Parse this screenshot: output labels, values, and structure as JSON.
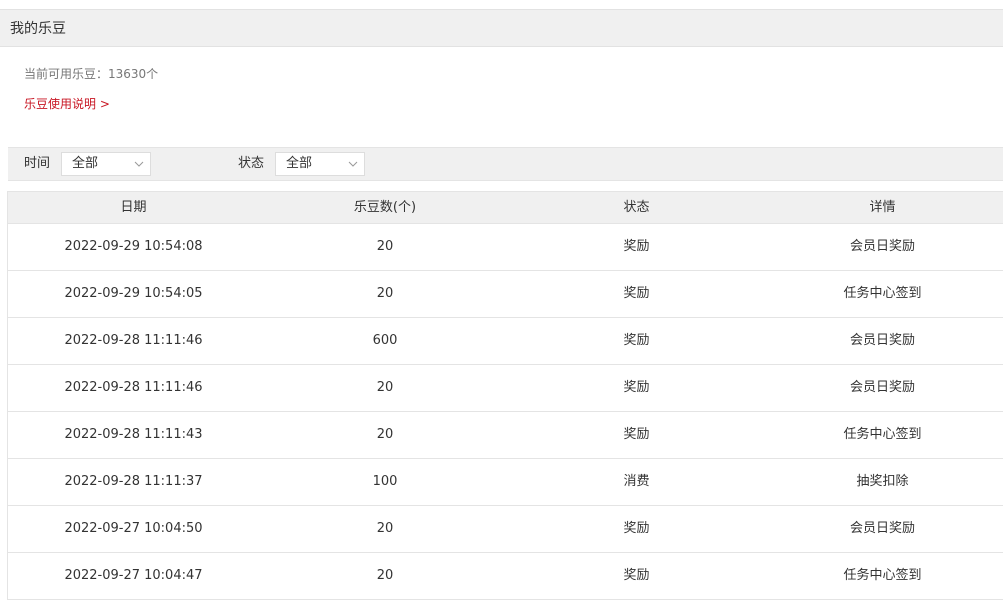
{
  "header": {
    "title": "我的乐豆"
  },
  "summary": {
    "balance_text": "当前可用乐豆：13630个",
    "help_link": "乐豆使用说明 >"
  },
  "filters": {
    "time_label": "时间",
    "time_value": "全部",
    "status_label": "状态",
    "status_value": "全部"
  },
  "table": {
    "columns": [
      "日期",
      "乐豆数(个)",
      "状态",
      "详情"
    ],
    "rows": [
      {
        "date": "2022-09-29 10:54:08",
        "amount": "20",
        "status": "奖励",
        "detail": "会员日奖励"
      },
      {
        "date": "2022-09-29 10:54:05",
        "amount": "20",
        "status": "奖励",
        "detail": "任务中心签到"
      },
      {
        "date": "2022-09-28 11:11:46",
        "amount": "600",
        "status": "奖励",
        "detail": "会员日奖励"
      },
      {
        "date": "2022-09-28 11:11:46",
        "amount": "20",
        "status": "奖励",
        "detail": "会员日奖励"
      },
      {
        "date": "2022-09-28 11:11:43",
        "amount": "20",
        "status": "奖励",
        "detail": "任务中心签到"
      },
      {
        "date": "2022-09-28 11:11:37",
        "amount": "100",
        "status": "消费",
        "detail": "抽奖扣除"
      },
      {
        "date": "2022-09-27 10:04:50",
        "amount": "20",
        "status": "奖励",
        "detail": "会员日奖励"
      },
      {
        "date": "2022-09-27 10:04:47",
        "amount": "20",
        "status": "奖励",
        "detail": "任务中心签到"
      }
    ]
  },
  "colors": {
    "header_bg": "#f0f0f0",
    "link_red": "#c81623",
    "border": "#e4e4e4"
  }
}
